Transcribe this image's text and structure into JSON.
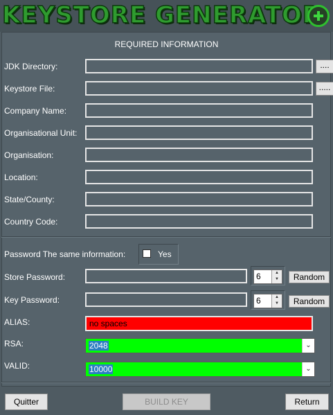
{
  "app": {
    "title": "KEYSTORE GENERATOR"
  },
  "section": {
    "title": "REQUIRED INFORMATION"
  },
  "fields": {
    "jdk": {
      "label": "JDK Directory:",
      "value": ""
    },
    "keystore": {
      "label": "Keystore File:",
      "value": ""
    },
    "company": {
      "label": "Company Name:",
      "value": ""
    },
    "unit": {
      "label": "Organisational Unit:",
      "value": ""
    },
    "organisation": {
      "label": "Organisation:",
      "value": ""
    },
    "location": {
      "label": "Location:",
      "value": ""
    },
    "state": {
      "label": "State/County:",
      "value": ""
    },
    "country": {
      "label": "Country Code:",
      "value": ""
    }
  },
  "browse": {
    "jdk_label": "....",
    "keystore_label": "....."
  },
  "password": {
    "same_label": "Password The same information:",
    "yes_label": "Yes",
    "same_checked": false,
    "store_label": "Store Password:",
    "store_value": "",
    "store_length": "6",
    "key_label": "Key Password:",
    "key_value": "",
    "key_length": "6",
    "random_label": "Random"
  },
  "alias": {
    "label": "ALIAS:",
    "value": "no spaces"
  },
  "rsa": {
    "label": "RSA:",
    "value": "2048"
  },
  "valid": {
    "label": "VALID:",
    "value": "10000"
  },
  "footer": {
    "quit_label": "Quitter",
    "build_label": "BUILD KEY",
    "return_label": "Return"
  },
  "colors": {
    "background": "#4f5b62",
    "alias_field": "#ff0000",
    "select_fields": "#00ff00",
    "title": "#2f9b2f"
  },
  "icons": {
    "add": "plus-circle-icon",
    "spin_up": "chevron-up-icon",
    "spin_down": "chevron-down-icon",
    "dropdown": "chevron-down-icon"
  }
}
